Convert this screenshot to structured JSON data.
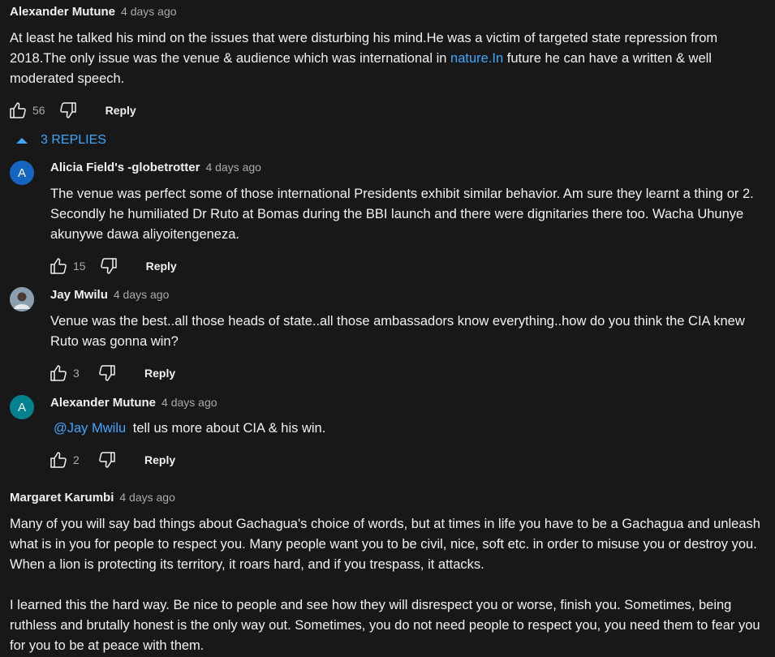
{
  "comments": [
    {
      "author": "Alexander Mutune",
      "time": "4 days ago",
      "text_before_link": "At least he talked his mind on the issues that were disturbing his mind.He was a victim of targeted state repression from 2018.The only issue was the venue & audience which was international in ",
      "link_text": "nature.In",
      "text_after_link": " future he can have a written & well moderated speech.",
      "likes": "56",
      "reply_label": "Reply"
    },
    {
      "author": "Margaret Karumbi",
      "time": "4 days ago",
      "paragraph1": "Many of you will say bad things about Gachagua's choice of words, but at times in life you have to be a Gachagua and unleash what is in you for people to respect you. Many people want you to be civil, nice, soft etc. in order to misuse you or destroy you. When a lion is protecting its territory, it roars hard, and if you trespass, it attacks.",
      "paragraph2": "I learned this the hard way. Be nice to people and see how they will disrespect you or worse, finish you.  Sometimes, being ruthless and brutally honest is the only way out. Sometimes, you do not need people to respect you, you need them to fear you for you to be at peace with them."
    }
  ],
  "replies_toggle": {
    "label": "3 REPLIES"
  },
  "replies": [
    {
      "author": "Alicia Field's -globetrotter",
      "time": "4 days ago",
      "avatar_letter": "A",
      "avatar_color": "#1565c0",
      "text": "The venue was perfect some of those international Presidents exhibit similar behavior. Am sure they learnt a thing or 2. Secondly he humiliated Dr Ruto at Bomas during the BBI launch and there were dignitaries there too. Wacha Uhunye akunywe dawa aliyoitengeneza.",
      "likes": "15",
      "reply_label": "Reply"
    },
    {
      "author": "Jay Mwilu",
      "time": "4 days ago",
      "text": "Venue was the best..all those heads of state..all those ambassadors know everything..how do you think the CIA knew Ruto was gonna win?",
      "likes": "3",
      "reply_label": "Reply"
    },
    {
      "author": "Alexander Mutune",
      "time": "4 days ago",
      "avatar_letter": "A",
      "avatar_color": "#00838f",
      "mention": "@Jay Mwilu",
      "text": " tell us more about CIA & his win.",
      "likes": "2",
      "reply_label": "Reply"
    }
  ],
  "icons": {
    "like": "thumbs-up-icon",
    "dislike": "thumbs-down-icon",
    "collapse": "caret-up-icon"
  },
  "colors": {
    "background": "#181818",
    "text": "#f1f1f1",
    "secondary": "#aaaaaa",
    "link": "#3ea6ff"
  }
}
